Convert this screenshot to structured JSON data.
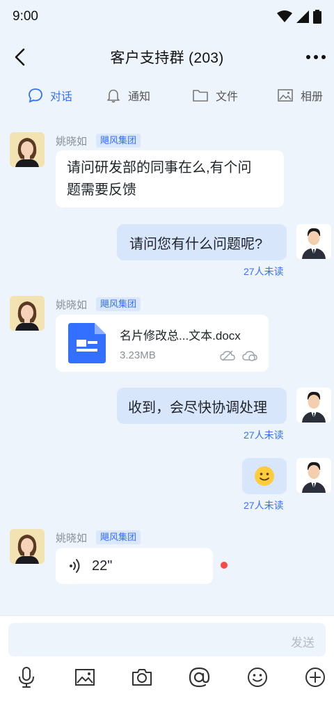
{
  "status_bar": {
    "time": "9:00"
  },
  "header": {
    "title": "客户支持群 (203)"
  },
  "tabs": [
    {
      "label": "对话",
      "icon": "chat-bubble-icon",
      "active": true
    },
    {
      "label": "通知",
      "icon": "bell-icon",
      "active": false
    },
    {
      "label": "文件",
      "icon": "folder-icon",
      "active": false
    },
    {
      "label": "相册",
      "icon": "image-icon",
      "active": false
    }
  ],
  "messages": [
    {
      "type": "text",
      "side": "left",
      "sender": "姚晓如",
      "org": "飓风集团",
      "text_line1": "请问研发部的同事在么,有个问",
      "text_line2": "题需要反馈"
    },
    {
      "type": "text",
      "side": "right",
      "text": "请问您有什么问题呢?",
      "read_status": "27人未读"
    },
    {
      "type": "file",
      "side": "left",
      "sender": "姚晓如",
      "org": "飓风集团",
      "file_name": "名片修改总...文本.docx",
      "file_size": "3.23MB"
    },
    {
      "type": "text",
      "side": "right",
      "text": "收到，会尽快协调处理",
      "read_status": "27人未读"
    },
    {
      "type": "emoji",
      "side": "right",
      "emoji": "🙂",
      "read_status": "27人未读"
    },
    {
      "type": "voice",
      "side": "left",
      "sender": "姚晓如",
      "org": "飓风集团",
      "duration": "22\"",
      "unread": true
    }
  ],
  "composer": {
    "send_label": "发送"
  },
  "toolbar": [
    "microphone-icon",
    "image-icon",
    "camera-icon",
    "at-icon",
    "emoji-icon",
    "plus-circle-icon"
  ],
  "colors": {
    "accent": "#3370ff",
    "background": "#eef4fb",
    "bubble_right": "#d8e6fb",
    "unread_dot": "#f54a45"
  }
}
